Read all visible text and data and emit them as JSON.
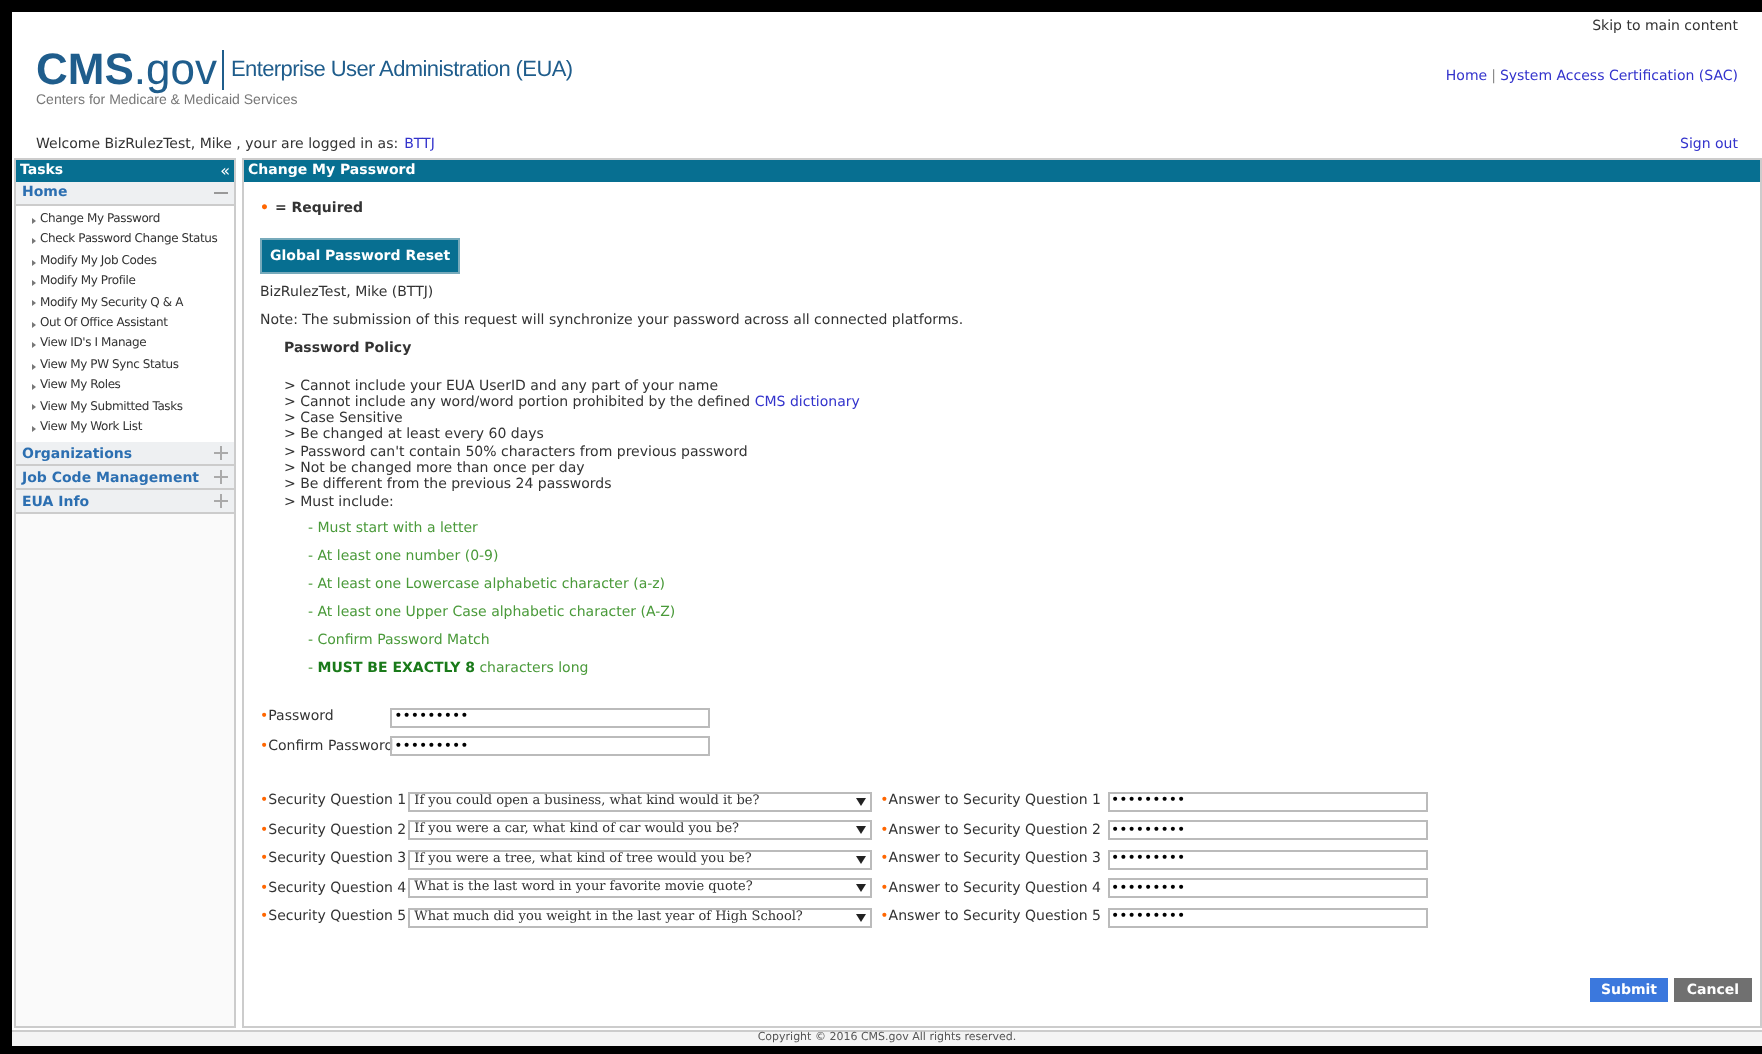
{
  "header": {
    "logo_main": "CMS",
    "logo_suffix": ".gov",
    "logo_subtitle": "Centers for Medicare & Medicaid Services",
    "app_title": "Enterprise User Administration (EUA)",
    "skip_link": "Skip to main content",
    "nav_links": [
      "Home",
      "System Access Certification (SAC)"
    ],
    "nav_separator": "|"
  },
  "welcome": {
    "text": "Welcome BizRulezTest, Mike , your are logged in as:",
    "user_id": "BTTJ",
    "sign_out": "Sign out"
  },
  "sidebar": {
    "title": "Tasks",
    "collapse_glyph": "«",
    "sections": [
      {
        "label": "Home",
        "expanded": true,
        "items": [
          "Change My Password",
          "Check Password Change Status",
          "Modify My Job Codes",
          "Modify My Profile",
          "Modify My Security Q & A",
          "Out Of Office Assistant",
          "View ID's I Manage",
          "View My PW Sync Status",
          "View My Roles",
          "View My Submitted Tasks",
          "View My Work List"
        ]
      },
      {
        "label": "Organizations",
        "expanded": false
      },
      {
        "label": "Job Code Management",
        "expanded": false
      },
      {
        "label": "EUA Info",
        "expanded": false
      }
    ]
  },
  "main": {
    "title": "Change My Password",
    "required_mark": "•",
    "required_text": "= Required",
    "reset_button": "Global Password Reset",
    "user_line": "BizRulezTest, Mike (BTTJ)",
    "note": "Note: The submission of this request will synchronize your password across all connected platforms.",
    "policy_title": "Password Policy",
    "rules": [
      {
        "text": "> Cannot include your EUA UserID and any part of your name"
      },
      {
        "text": "> Cannot include any word/word portion prohibited by the defined",
        "link": "CMS dictionary"
      },
      {
        "text": "> Case Sensitive"
      },
      {
        "text": "> Be changed at least every 60 days"
      },
      {
        "text": "> Password can't contain 50% characters from previous password"
      },
      {
        "text": "> Not be changed more than once per day"
      },
      {
        "text": "> Be different from the previous 24 passwords"
      },
      {
        "text": "> Must include:"
      }
    ],
    "requirements": [
      "- Must start with a letter",
      "- At least one number (0-9)",
      "- At least one Lowercase alphabetic character (a-z)",
      "- At least one Upper Case alphabetic character (A-Z)",
      "- Confirm Password Match",
      "- **MUST BE EXACTLY 8** characters long"
    ],
    "password_fields": [
      {
        "mark": "•",
        "label": "Password",
        "value": "•••••••••"
      },
      {
        "mark": "•",
        "label": "Confirm Password",
        "value": "•••••••••"
      }
    ],
    "security_questions": [
      {
        "mark": "•",
        "label": "Security Question 1",
        "question": "If you could open a business, what kind would it be?",
        "answer_mark": "•",
        "answer_label": "Answer to Security Question 1",
        "answer": "•••••••••"
      },
      {
        "mark": "•",
        "label": "Security Question 2",
        "question": "If you were a car, what kind of car would you be?",
        "answer_mark": "•",
        "answer_label": "Answer to Security Question 2",
        "answer": "•••••••••"
      },
      {
        "mark": "•",
        "label": "Security Question 3",
        "question": "If you were a tree, what kind of tree would you be?",
        "answer_mark": "•",
        "answer_label": "Answer to Security Question 3",
        "answer": "•••••••••"
      },
      {
        "mark": "•",
        "label": "Security Question 4",
        "question": "What is the last word in your favorite movie quote?",
        "answer_mark": "•",
        "answer_label": "Answer to Security Question 4",
        "answer": "•••••••••"
      },
      {
        "mark": "•",
        "label": "Security Question 5",
        "question": "What much did you weight in the last year of High School?",
        "answer_mark": "•",
        "answer_label": "Answer to Security Question 5",
        "answer": "•••••••••"
      }
    ],
    "buttons": [
      {
        "kind": "primary",
        "label": "Submit"
      },
      {
        "kind": "secondary",
        "label": "Cancel"
      }
    ]
  },
  "footer": "Copyright © 2016 CMS.gov All rights reserved."
}
